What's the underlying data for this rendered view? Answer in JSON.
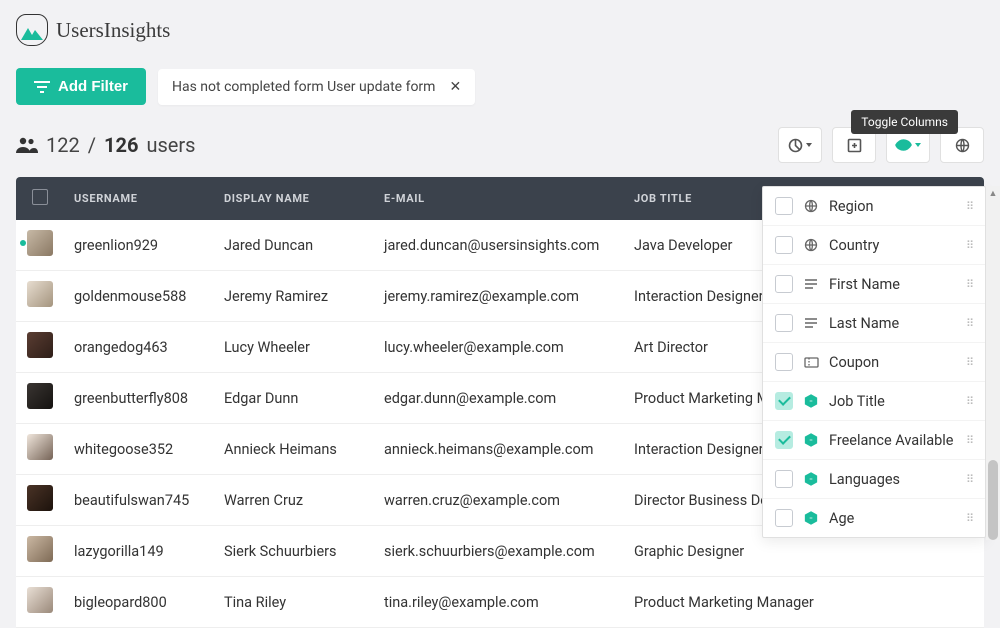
{
  "brand": {
    "name": "UsersInsights"
  },
  "toolbar": {
    "add_filter_label": "Add Filter",
    "active_filter": "Has not completed form User update form"
  },
  "count": {
    "shown": "122",
    "sep": "/",
    "total": "126",
    "suffix": "users"
  },
  "action_buttons": {
    "segments": "segments",
    "export": "export",
    "toggle_columns": "toggle-columns",
    "map": "map"
  },
  "tooltip": "Toggle Columns",
  "columns": [
    "USERNAME",
    "DISPLAY NAME",
    "E-MAIL",
    "JOB TITLE"
  ],
  "rows": [
    {
      "online": true,
      "username": "greenlion929",
      "display": "Jared Duncan",
      "email": "jared.duncan@usersinsights.com",
      "job": "Java Developer"
    },
    {
      "online": false,
      "username": "goldenmouse588",
      "display": "Jeremy Ramirez",
      "email": "jeremy.ramirez@example.com",
      "job": "Interaction Designer"
    },
    {
      "online": false,
      "username": "orangedog463",
      "display": "Lucy Wheeler",
      "email": "lucy.wheeler@example.com",
      "job": "Art Director"
    },
    {
      "online": false,
      "username": "greenbutterfly808",
      "display": "Edgar Dunn",
      "email": "edgar.dunn@example.com",
      "job": "Product Marketing Manager"
    },
    {
      "online": false,
      "username": "whitegoose352",
      "display": "Annieck Heimans",
      "email": "annieck.heimans@example.com",
      "job": "Interaction Designer"
    },
    {
      "online": false,
      "username": "beautifulswan745",
      "display": "Warren Cruz",
      "email": "warren.cruz@example.com",
      "job": "Director Business Development"
    },
    {
      "online": false,
      "username": "lazygorilla149",
      "display": "Sierk Schuurbiers",
      "email": "sierk.schuurbiers@example.com",
      "job": "Graphic Designer"
    },
    {
      "online": false,
      "username": "bigleopard800",
      "display": "Tina Riley",
      "email": "tina.riley@example.com",
      "job": "Product Marketing Manager"
    }
  ],
  "avatar_gradients": [
    [
      "#c7b9a6",
      "#8a7863"
    ],
    [
      "#e7ddd0",
      "#a4947e"
    ],
    [
      "#5a3d32",
      "#2e1e18"
    ],
    [
      "#3a3532",
      "#141210"
    ],
    [
      "#f0e6dc",
      "#756356"
    ],
    [
      "#4a3326",
      "#1c120c"
    ],
    [
      "#cbb8a3",
      "#7e6a55"
    ],
    [
      "#e9dfd5",
      "#9a897a"
    ]
  ],
  "dropdown": {
    "items": [
      {
        "checked": false,
        "icon": "globe",
        "icon_style": "grey",
        "label": "Region"
      },
      {
        "checked": false,
        "icon": "globe",
        "icon_style": "grey",
        "label": "Country"
      },
      {
        "checked": false,
        "icon": "lines",
        "icon_style": "grey",
        "label": "First Name"
      },
      {
        "checked": false,
        "icon": "lines",
        "icon_style": "grey",
        "label": "Last Name"
      },
      {
        "checked": false,
        "icon": "ticket",
        "icon_style": "grey",
        "label": "Coupon"
      },
      {
        "checked": true,
        "icon": "hex",
        "icon_style": "teal",
        "label": "Job Title"
      },
      {
        "checked": true,
        "icon": "hex",
        "icon_style": "teal",
        "label": "Freelance Available"
      },
      {
        "checked": false,
        "icon": "hex",
        "icon_style": "teal",
        "label": "Languages"
      },
      {
        "checked": false,
        "icon": "hex",
        "icon_style": "teal",
        "label": "Age"
      }
    ]
  }
}
